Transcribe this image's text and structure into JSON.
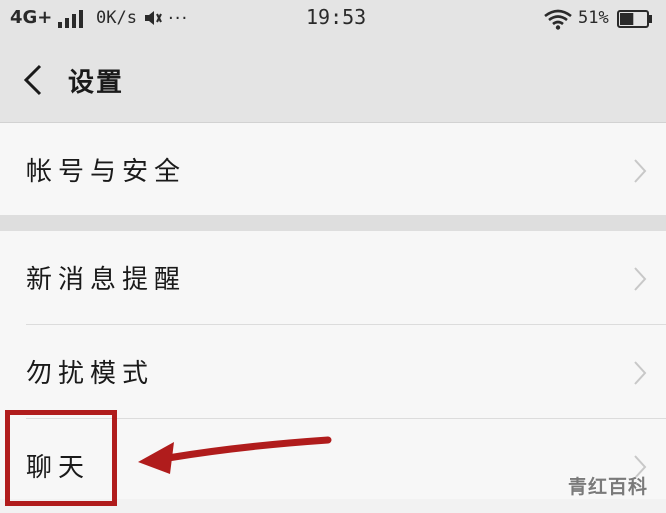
{
  "status_bar": {
    "network": "4G+",
    "speed": "0K/s",
    "clock": "19:53",
    "battery_percent": "51%",
    "battery_level": 0.51,
    "icons": [
      "signal-icon",
      "vibrate-icon",
      "more-dots-icon",
      "wifi-icon",
      "battery-icon"
    ],
    "more_dots": "···"
  },
  "header": {
    "title": "设置",
    "back_icon": "chevron-left-icon"
  },
  "settings": {
    "group1": [
      {
        "label": "帐号与安全"
      }
    ],
    "group2": [
      {
        "label": "新消息提醒"
      },
      {
        "label": "勿扰模式"
      },
      {
        "label": "聊天"
      }
    ]
  },
  "annotation": {
    "color": "#b01c1c",
    "highlight_target": "聊天"
  },
  "watermark": "青红百科",
  "colors": {
    "background": "#f2f2f2",
    "header_bg": "#e4e4e4",
    "row_bg": "#f7f7f7",
    "chevron": "#c8c8c8"
  }
}
